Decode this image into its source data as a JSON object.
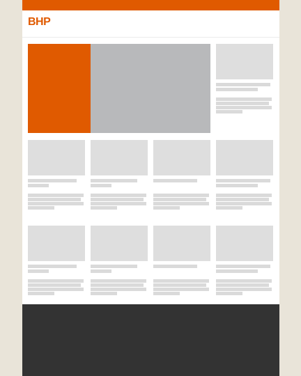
{
  "brand": {
    "logo_text": "BHP",
    "accent_color": "#e05a00",
    "background_color": "#e9e4d9",
    "footer_color": "#333333"
  },
  "hero": {
    "image_placeholder_color": "#b8b9bb"
  },
  "placeholder_color": "#dedede"
}
